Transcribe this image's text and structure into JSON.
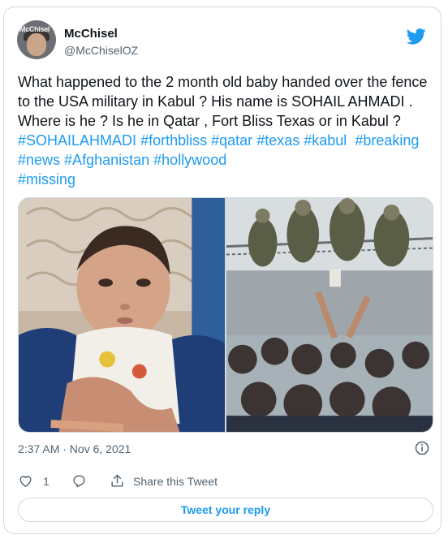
{
  "tweet": {
    "author": {
      "name": "McChisel",
      "handle": "@McChiselOZ",
      "avatar_label": "McChisel"
    },
    "text_segments": [
      {
        "text": "What happened to the 2 month old baby handed over the fence to the USA military in Kabul ? His name is SOHAIL AHMADI . Where is he ? Is he in Qatar , Fort Bliss Texas or in Kabul ? ",
        "hashtag": false
      },
      {
        "text": "#SOHAILAHMADI",
        "hashtag": true
      },
      {
        "text": " ",
        "hashtag": false
      },
      {
        "text": "#forthbliss",
        "hashtag": true
      },
      {
        "text": " ",
        "hashtag": false
      },
      {
        "text": "#qatar",
        "hashtag": true
      },
      {
        "text": " ",
        "hashtag": false
      },
      {
        "text": "#texas",
        "hashtag": true
      },
      {
        "text": " ",
        "hashtag": false
      },
      {
        "text": "#kabul",
        "hashtag": true
      },
      {
        "text": "  ",
        "hashtag": false
      },
      {
        "text": "#breaking",
        "hashtag": true
      },
      {
        "text": " ",
        "hashtag": false
      },
      {
        "text": "#news",
        "hashtag": true
      },
      {
        "text": " ",
        "hashtag": false
      },
      {
        "text": "#Afghanistan",
        "hashtag": true
      },
      {
        "text": " ",
        "hashtag": false
      },
      {
        "text": "#hollywood",
        "hashtag": true
      },
      {
        "text": "\n",
        "hashtag": false
      },
      {
        "text": "#missing",
        "hashtag": true
      }
    ],
    "timestamp": "2:37 AM · Nov 6, 2021",
    "like_count": "1",
    "share_label": "Share this Tweet",
    "reply_button_label": "Tweet your reply"
  },
  "icons": {
    "brand": "twitter-bird-icon",
    "info": "info-icon",
    "like": "heart-icon",
    "reply": "reply-icon",
    "share": "share-icon"
  },
  "colors": {
    "accent": "#1d9bf0",
    "text": "#0f1419",
    "muted": "#536471",
    "border": "#cfd9de"
  }
}
